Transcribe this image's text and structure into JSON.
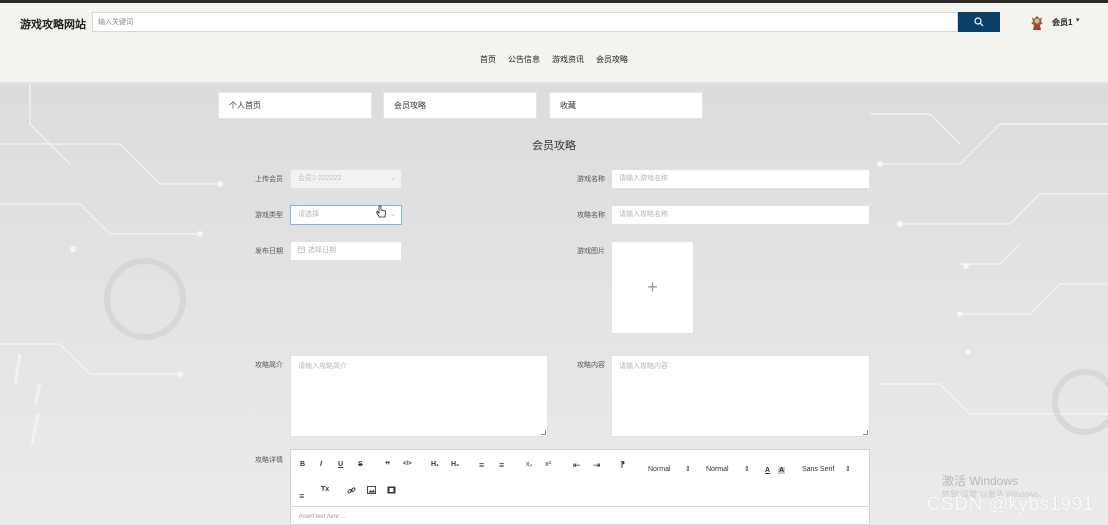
{
  "header": {
    "site_title": "游戏攻略网站",
    "search_placeholder": "输入关键词",
    "user_name": "会员1",
    "user_caret": "▾"
  },
  "nav": [
    "首页",
    "公告信息",
    "游戏资讯",
    "会员攻略"
  ],
  "tabs": [
    "个人首页",
    "会员攻略",
    "收藏"
  ],
  "form": {
    "title": "会员攻略",
    "uploader_label": "上传会员",
    "uploader_value": "会员1-222222",
    "game_name_label": "游戏名称",
    "game_name_placeholder": "请输入游戏名称",
    "game_type_label": "游戏类型",
    "game_type_placeholder": "请选择",
    "guide_name_label": "攻略名称",
    "guide_name_placeholder": "请输入攻略名称",
    "publish_date_label": "发布日期",
    "publish_date_placeholder": "选择日期",
    "game_image_label": "游戏图片",
    "upload_plus": "+",
    "intro_label": "攻略简介",
    "intro_placeholder": "请输入攻略简介",
    "content_label": "攻略内容",
    "content_placeholder": "请输入攻略内容",
    "detail_label": "攻略详情"
  },
  "editor": {
    "bold": "B",
    "italic": "I",
    "underline": "U",
    "strike": "S",
    "quote": "❞",
    "code": "</>",
    "h1": "H₁",
    "h2": "H₂",
    "ol": "≡",
    "ul": "≡",
    "sub": "x₂",
    "sup": "x²",
    "outdent": "⇤",
    "indent": "⇥",
    "direction": "⁋",
    "size": "Normal",
    "header": "Normal",
    "font": "Sans Serif",
    "select_arrow": "⇕",
    "color": "A",
    "background": "A",
    "align": "≡",
    "clean": "Tx",
    "placeholder": "Insert text here ..."
  },
  "watermarks": {
    "windows_1": "激活 Windows",
    "windows_2": "转到\"设置\"以激活 Windows。",
    "csdn": "CSDN @kybs1991"
  },
  "colors": {
    "header_bg": "#f5f3ee",
    "search_button": "#0c3f67",
    "page_bg": "#e6e6e6"
  }
}
